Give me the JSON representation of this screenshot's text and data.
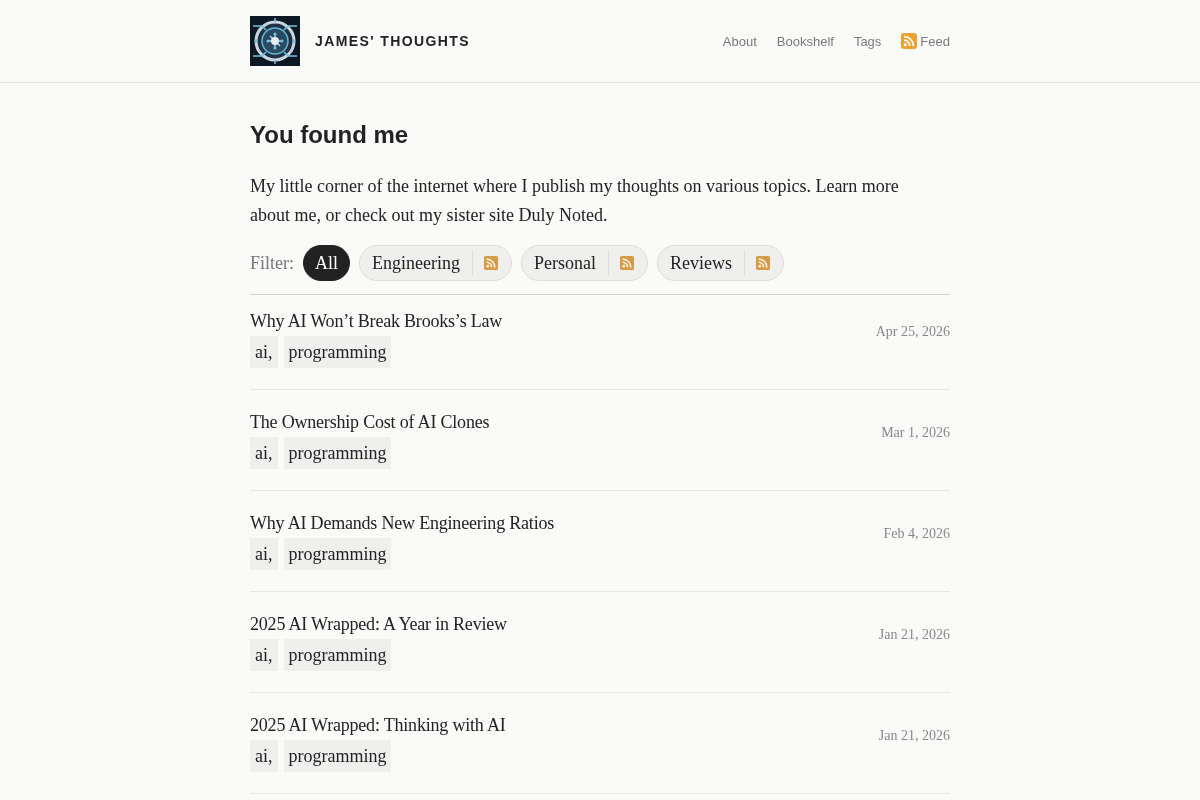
{
  "header": {
    "site_title": "JAMES' THOUGHTS",
    "nav": [
      {
        "label": "About",
        "kind": "link"
      },
      {
        "label": "Bookshelf",
        "kind": "link"
      },
      {
        "label": "Tags",
        "kind": "link"
      },
      {
        "label": "Feed",
        "kind": "feed"
      }
    ]
  },
  "intro": {
    "heading": "You found me",
    "text": "My little corner of the internet where I publish my thoughts on various topics. Learn more about me, or check out my sister site Duly Noted."
  },
  "filter": {
    "label": "Filter:",
    "options": [
      {
        "label": "All",
        "selected": true,
        "feed": false
      },
      {
        "label": "Engineering",
        "selected": false,
        "feed": true
      },
      {
        "label": "Personal",
        "selected": false,
        "feed": true
      },
      {
        "label": "Reviews",
        "selected": false,
        "feed": true
      }
    ]
  },
  "posts": [
    {
      "title": "Why AI Won’t Break Brooks’s Law",
      "tags": [
        "ai,",
        "programming"
      ],
      "date": "Apr 25, 2026"
    },
    {
      "title": "The Ownership Cost of AI Clones",
      "tags": [
        "ai,",
        "programming"
      ],
      "date": "Mar 1, 2026"
    },
    {
      "title": "Why AI Demands New Engineering Ratios",
      "tags": [
        "ai,",
        "programming"
      ],
      "date": "Feb 4, 2026"
    },
    {
      "title": "2025 AI Wrapped: A Year in Review",
      "tags": [
        "ai,",
        "programming"
      ],
      "date": "Jan 21, 2026"
    },
    {
      "title": "2025 AI Wrapped: Thinking with AI",
      "tags": [
        "ai,",
        "programming"
      ],
      "date": "Jan 21, 2026"
    }
  ]
}
